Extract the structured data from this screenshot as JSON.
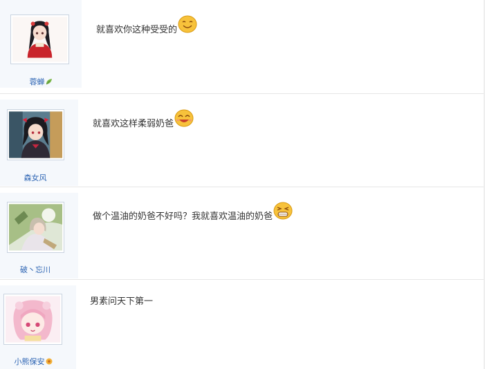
{
  "posts": [
    {
      "user": "蓉蝉",
      "content": "就喜欢你这种受受的",
      "emoji": "smile-emoji",
      "badge": "leaf-badge-icon"
    },
    {
      "user": "森女风",
      "content": "就喜欢这样柔弱奶爸",
      "emoji": "laugh-emoji",
      "badge": ""
    },
    {
      "user": "破丶忘川",
      "content": "做个温油的奶爸不好吗？我就喜欢温油的奶爸",
      "emoji": "grin-emoji",
      "badge": ""
    },
    {
      "user": "小熊保安",
      "content": "男素问天下第一",
      "emoji": "",
      "badge": "flower-badge-icon"
    }
  ],
  "colors": {
    "username": "#2d64b3",
    "user_column_bg": "#f5f8fc",
    "divider": "#e6e6e6",
    "emoji_fill": "#f7c23b"
  }
}
